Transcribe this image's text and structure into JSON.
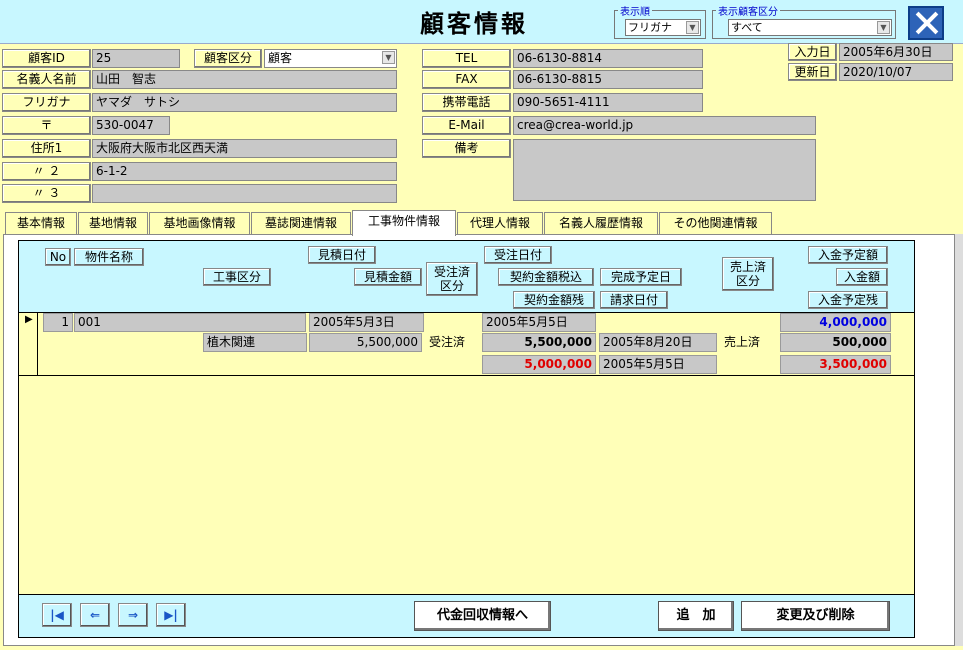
{
  "header": {
    "title": "顧客情報",
    "sort_order": {
      "legend": "表示順",
      "value": "フリガナ"
    },
    "customer_filter": {
      "legend": "表示顧客区分",
      "value": "すべて"
    }
  },
  "customer": {
    "id_label": "顧客ID",
    "id": "25",
    "category_label": "顧客区分",
    "category": "顧客",
    "name_label": "名義人名前",
    "name": "山田　智志",
    "furigana_label": "フリガナ",
    "furigana": "ヤマダ　サトシ",
    "zip_label": "〒",
    "zip": "530-0047",
    "addr1_label": "住所1",
    "addr1": "大阪府大阪市北区西天満",
    "addr2_label": "〃 ２",
    "addr2": "6-1-2",
    "addr3_label": "〃 ３",
    "addr3": "",
    "tel_label": "TEL",
    "tel": "06-6130-8814",
    "fax_label": "FAX",
    "fax": "06-6130-8815",
    "mobile_label": "携帯電話",
    "mobile": "090-5651-4111",
    "email_label": "E-Mail",
    "email": "crea@crea-world.jp",
    "note_label": "備考",
    "note": "",
    "entry_date_label": "入力日",
    "entry_date": "2005年6月30日",
    "update_date_label": "更新日",
    "update_date": "2020/10/07"
  },
  "tabs": [
    "基本情報",
    "基地情報",
    "基地画像情報",
    "墓誌関連情報",
    "工事物件情報",
    "代理人情報",
    "名義人履歴情報",
    "その他関連情報"
  ],
  "grid": {
    "headers": {
      "no": "No",
      "name": "物件名称",
      "work_type": "工事区分",
      "est_date": "見積日付",
      "est_amount": "見積金額",
      "ordered": "受注済\n区分",
      "order_date": "受注日付",
      "contract_tax": "契約金額税込",
      "contract_remain": "契約金額残",
      "completion": "完成予定日",
      "invoice_date": "請求日付",
      "sold": "売上済\n区分",
      "expected_payment": "入金予定額",
      "payment": "入金額",
      "remaining": "入金予定残"
    },
    "row": {
      "no": "1",
      "name": "001",
      "work_type": "植木関連",
      "est_date": "2005年5月3日",
      "est_amount": "5,500,000",
      "ordered": "受注済",
      "order_date": "2005年5月5日",
      "contract_tax": "5,500,000",
      "contract_remain": "5,000,000",
      "completion": "2005年8月20日",
      "invoice_date": "2005年5月5日",
      "sold": "売上済",
      "expected_payment": "4,000,000",
      "payment": "500,000",
      "remaining": "3,500,000"
    }
  },
  "footer": {
    "nav_first": "|◀",
    "nav_prev": "⇐",
    "nav_next": "⇒",
    "nav_last": "▶|",
    "collection_button": "代金回収情報へ",
    "add_button": "追　加",
    "edit_delete_button": "変更及び削除"
  },
  "colors": {
    "background": "#FFFFB8",
    "header_cyan": "#C8F7FF",
    "amount_blue": "#0000E0",
    "amount_red": "#E00000"
  }
}
